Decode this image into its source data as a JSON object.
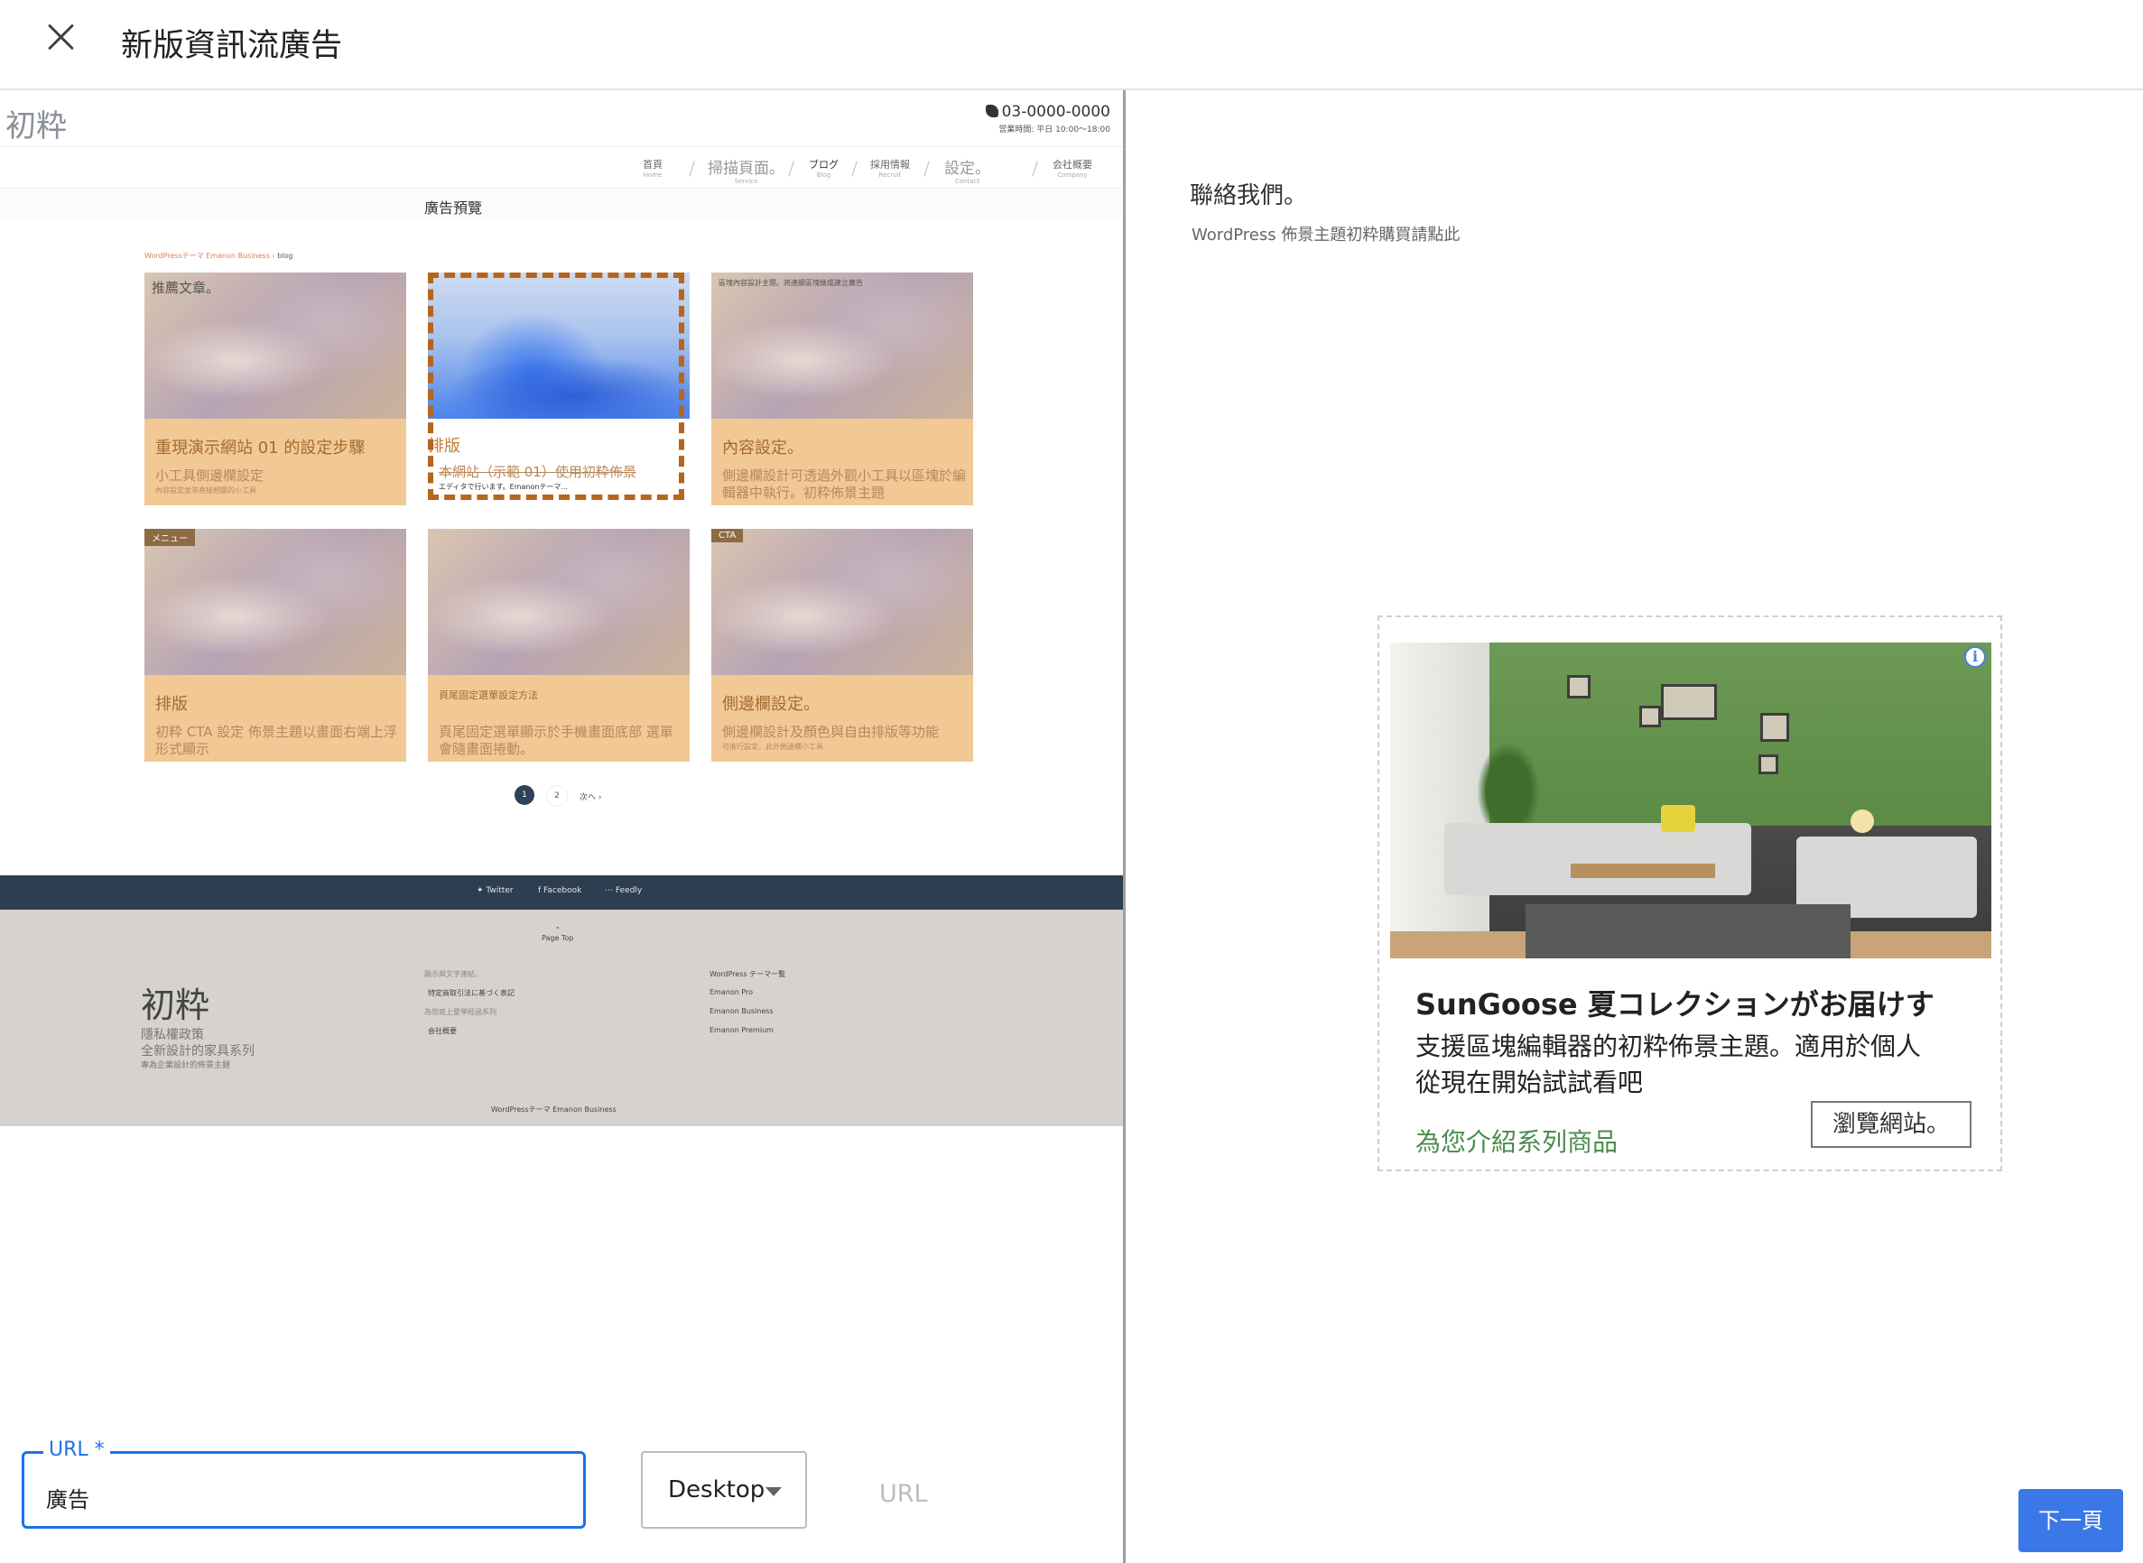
{
  "header": {
    "title": "新版資訊流廣告"
  },
  "preview": {
    "site": {
      "logo": "初粋",
      "phone": "03-0000-0000",
      "hours": "営業時間: 平日 10:00〜18:00",
      "nav": [
        {
          "label": "首頁",
          "sub": "Home"
        },
        {
          "label": "掃描頁面。",
          "sub": "Service"
        },
        {
          "label": "ブログ",
          "sub": "Blog"
        },
        {
          "label": "採用情報",
          "sub": "Recruit"
        },
        {
          "label": "設定。",
          "sub": "Contact"
        },
        {
          "label": "会社概要",
          "sub": "Company"
        }
      ],
      "preview_label": "廣告預覽",
      "breadcrumb": {
        "root": "WordPressテーマ Emanon Business",
        "current": "blog"
      },
      "cards": [
        {
          "tag": "推薦文章。",
          "title": "重現演示網站 01 的設定步驟",
          "text": "小工具側邊欄設定",
          "small": "內容設定並非直接相關的小工具"
        },
        {
          "tag": "",
          "title": "排版",
          "text": "本網站（示範 01）使用初粋佈景",
          "small": "エディタで行います。Emanonテーマ..."
        },
        {
          "tag": "區塊內容設計主題。將連續區塊做成建立廣告",
          "title": "內容設定。",
          "text": "側邊欄設計可透過外觀小工具以區塊於編輯器中執行。初粋佈景主題",
          "small": ""
        },
        {
          "tag": "メニュー",
          "title": "排版",
          "text": "初粋 CTA 設定 佈景主題以畫面右端上浮形式顯示",
          "small": ""
        },
        {
          "tag": "",
          "title": "頁尾固定選單設定方法",
          "text": "頁尾固定選單顯示於手機畫面底部 選單會隨畫面捲動。",
          "small": ""
        },
        {
          "tag": "CTA",
          "title": "側邊欄設定。",
          "text": "側邊欄設計及顏色與自由排版等功能",
          "small": "可進行設定，此外側邊欄小工具"
        }
      ],
      "pagination": {
        "current": "1",
        "next_page": "2",
        "next_label": "次へ ›"
      },
      "social": [
        "Twitter",
        "Facebook",
        "Feedly"
      ],
      "footer": {
        "page_top": "Page Top",
        "logo": "初粋",
        "tagline1": "隱私權政策",
        "tagline2": "全新設計的家具系列",
        "tagline3": "專為企業設計的佈景主題",
        "links_col1": [
          "顯示與文字連結。",
          "特定商取引法に基づく表記",
          "為您庭上愛學經過系列",
          "会社概要"
        ],
        "links_col2": [
          "WordPress テーマ一覧",
          "Emanon Pro",
          "Emanon Business",
          "Emanon Premium"
        ],
        "copyright": "WordPressテーマ Emanon Business"
      }
    }
  },
  "ad": {
    "contact_title": "聯絡我們。",
    "contact_sub": "WordPress 佈景主題初粋購買請點此",
    "image_icon": "info-icon",
    "headline": "SunGoose 夏コレクションがお届けす",
    "body1": "支援區塊編輯器的初粋佈景主題。適用於個人",
    "body2": "從現在開始試試看吧",
    "link": "為您介紹系列商品",
    "cta": "瀏覽網站。"
  },
  "controls": {
    "url_label": "URL *",
    "url_value": "廣告",
    "device": "Desktop",
    "url_button": "URL",
    "next_button": "下一頁"
  },
  "colors": {
    "accent": "#1a73e8",
    "next_button": "#3b78e7",
    "ad_link": "#4a8c4c",
    "card_bg": "#f2c995"
  }
}
